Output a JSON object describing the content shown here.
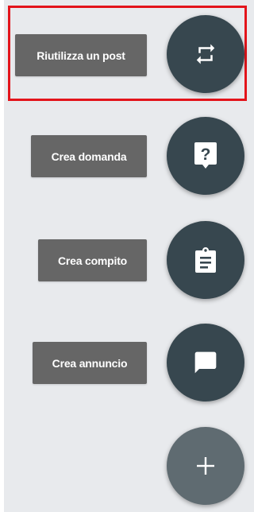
{
  "menu": {
    "reuse_post_label": "Riutilizza un post",
    "create_question_label": "Crea domanda",
    "create_assignment_label": "Crea compito",
    "create_announcement_label": "Crea annuncio"
  },
  "icons": {
    "reuse": "repeat-icon",
    "question": "question-icon",
    "assignment": "clipboard-icon",
    "announcement": "message-icon",
    "add": "plus-icon"
  },
  "colors": {
    "panel_bg": "#e8eaed",
    "chip_bg": "#666666",
    "fab_bg": "#37474f",
    "main_fab_bg": "#5f6b71",
    "highlight": "#e3141b"
  }
}
